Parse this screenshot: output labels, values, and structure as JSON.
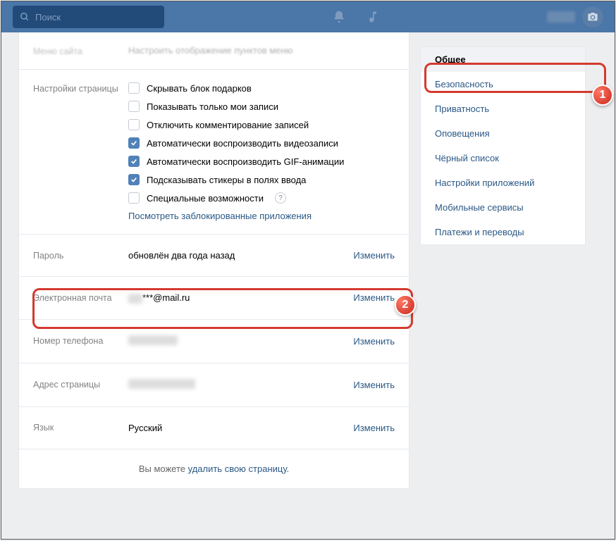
{
  "topbar": {
    "search_placeholder": "Поиск"
  },
  "menu_section": {
    "label": "Меню сайта",
    "desc": "Настроить отображение пунктов меню"
  },
  "page_settings": {
    "label": "Настройки страницы",
    "checks": [
      {
        "label": "Скрывать блок подарков",
        "checked": false
      },
      {
        "label": "Показывать только мои записи",
        "checked": false
      },
      {
        "label": "Отключить комментирование записей",
        "checked": false
      },
      {
        "label": "Автоматически воспроизводить видеозаписи",
        "checked": true
      },
      {
        "label": "Автоматически воспроизводить GIF-анимации",
        "checked": true
      },
      {
        "label": "Подсказывать стикеры в полях ввода",
        "checked": true
      },
      {
        "label": "Специальные возможности",
        "checked": false,
        "help": true
      }
    ],
    "blocked_link": "Посмотреть заблокированные приложения"
  },
  "rows": {
    "password": {
      "label": "Пароль",
      "value": "обновлён два года назад",
      "action": "Изменить"
    },
    "email": {
      "label": "Электронная почта",
      "value": "***@mail.ru",
      "action": "Изменить"
    },
    "phone": {
      "label": "Номер телефона",
      "value": "",
      "action": "Изменить"
    },
    "address": {
      "label": "Адрес страницы",
      "value": "",
      "action": "Изменить"
    },
    "lang": {
      "label": "Язык",
      "value": "Русский",
      "action": "Изменить"
    }
  },
  "delete": {
    "prefix": "Вы можете ",
    "link": "удалить свою страницу."
  },
  "sidebar": {
    "items": [
      {
        "label": "Общее",
        "active": true
      },
      {
        "label": "Безопасность"
      },
      {
        "label": "Приватность"
      },
      {
        "label": "Оповещения"
      },
      {
        "label": "Чёрный список"
      },
      {
        "label": "Настройки приложений"
      },
      {
        "label": "Мобильные сервисы"
      },
      {
        "label": "Платежи и переводы"
      }
    ]
  }
}
